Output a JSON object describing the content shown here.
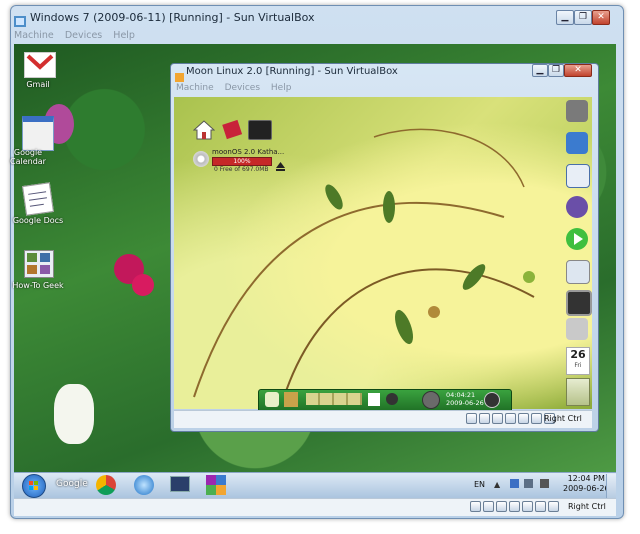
{
  "outer_window": {
    "title": "Windows 7 (2009-06-11) [Running] - Sun VirtualBox",
    "menu": [
      "Machine",
      "Devices",
      "Help"
    ],
    "controls": [
      "minimize",
      "restore",
      "close"
    ]
  },
  "desktop_icons": [
    {
      "label": "Gmail",
      "icon": "gmail-icon"
    },
    {
      "label": "Google Calendar",
      "icon": "calendar-icon"
    },
    {
      "label": "Google Docs",
      "icon": "docs-icon"
    },
    {
      "label": "How-To Geek",
      "icon": "howtogeek-icon"
    }
  ],
  "inner_window": {
    "title": "Moon Linux 2.0 [Running] - Sun VirtualBox",
    "menu": [
      "Machine",
      "Devices",
      "Help"
    ],
    "disk_widget": {
      "name": "moonOS 2.0 Katha...",
      "percent": "100%",
      "free": "0 Free of 697.0MB"
    },
    "clock": {
      "time": "04:04:21",
      "date": "2009-06-26"
    },
    "calendar_day": "26",
    "calendar_weekday": "Fri",
    "host_key": "Right Ctrl",
    "dock_items": [
      "home-icon",
      "book-icon",
      "terminal-icon"
    ],
    "side_dock": [
      "gimp-icon",
      "network-icon",
      "editor-icon",
      "pidgin-icon",
      "media-player-icon",
      "files-icon",
      "monitor-icon",
      "printer-icon",
      "calendar-icon",
      "trash-icon"
    ]
  },
  "taskbar": {
    "search_label": "Google",
    "language": "EN",
    "time": "12:04 PM",
    "date": "2009-06-26",
    "apps": [
      "chrome-icon",
      "ie-icon",
      "monitor-icon",
      "virtualbox-icon"
    ]
  },
  "outer_status": {
    "host_key": "Right Ctrl"
  },
  "colors": {
    "guest_bg": "#c7d86a",
    "taskbar_bg": "#c5d8ec",
    "accent_green": "#2e8b3a"
  }
}
